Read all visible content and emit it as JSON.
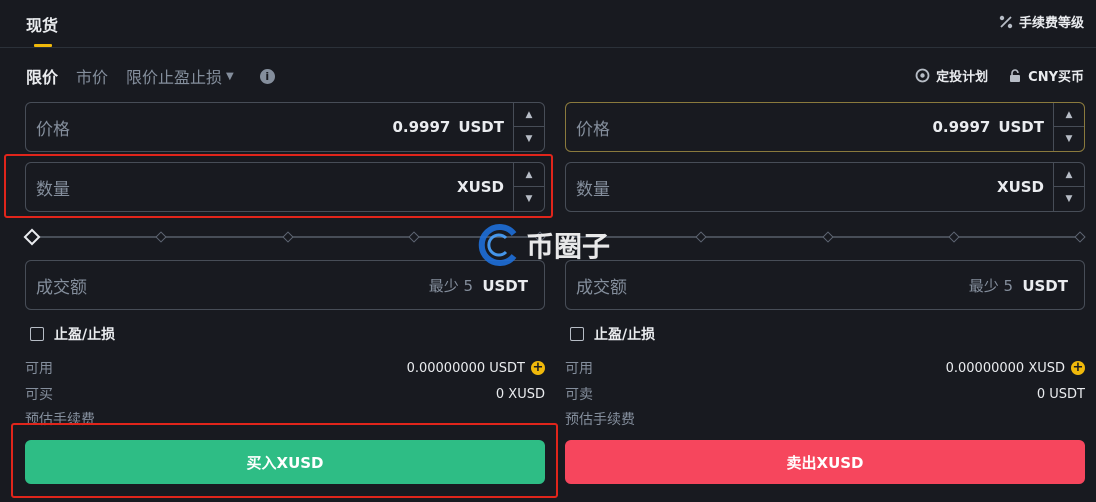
{
  "header": {
    "tab_spot": "现货",
    "fee_level": "手续费等级"
  },
  "order_types": {
    "limit": "限价",
    "market": "市价",
    "stop_limit": "限价止盈止损"
  },
  "links": {
    "recurring_plan": "定投计划",
    "buy_cny": "CNY买币"
  },
  "buy": {
    "price_label": "价格",
    "price_value": "0.9997",
    "price_unit": "USDT",
    "qty_label": "数量",
    "qty_unit": "XUSD",
    "total_label": "成交额",
    "total_min": "最少 5",
    "total_unit": "USDT",
    "tpsl": "止盈/止损",
    "avail_label": "可用",
    "avail_value": "0.00000000 USDT",
    "can_label": "可买",
    "can_value": "0 XUSD",
    "fee_label": "预估手续费",
    "action": "买入XUSD"
  },
  "sell": {
    "price_label": "价格",
    "price_value": "0.9997",
    "price_unit": "USDT",
    "qty_label": "数量",
    "qty_unit": "XUSD",
    "total_label": "成交额",
    "total_min": "最少 5",
    "total_unit": "USDT",
    "tpsl": "止盈/止损",
    "avail_label": "可用",
    "avail_value": "0.00000000 XUSD",
    "can_label": "可卖",
    "can_value": "0 USDT",
    "fee_label": "预估手续费",
    "action": "卖出XUSD"
  },
  "watermark": "币圈子",
  "colors": {
    "buy": "#2ebd85",
    "sell": "#f6465d",
    "accent": "#f0b90b",
    "highlight": "#e0251b"
  }
}
